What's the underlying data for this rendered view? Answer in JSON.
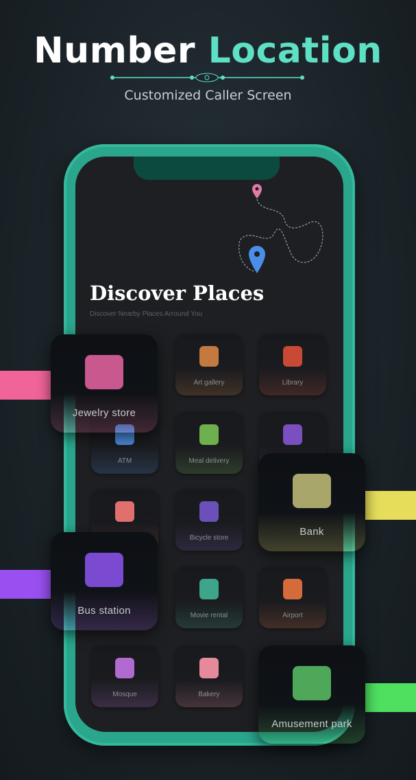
{
  "header": {
    "title_part1": "Number",
    "title_part2": "Location",
    "subtitle": "Customized Caller Screen"
  },
  "screen": {
    "title": "Discover Places",
    "subtitle": "Discover Nearby Places Arround You"
  },
  "tiles": [
    {
      "label": "Art gallery",
      "icon": "picture-frame-icon",
      "color": "#c47a3e"
    },
    {
      "label": "Library",
      "icon": "books-icon",
      "color": "#c84a35"
    },
    {
      "label": "ATM",
      "icon": "atm-machine-icon",
      "color": "#4a86d4"
    },
    {
      "label": "Meal delivery",
      "icon": "delivery-bag-icon",
      "color": "#6fb04e"
    },
    {
      "label": "",
      "icon": "auction-gavel-icon",
      "color": "#7a4fc0"
    },
    {
      "label": "",
      "icon": "hair-salon-icon",
      "color": "#e0706e"
    },
    {
      "label": "Bicycle store",
      "icon": "bicycle-icon",
      "color": "#6a50b8"
    },
    {
      "label": "Movie rental",
      "icon": "clapperboard-icon",
      "color": "#3da58a"
    },
    {
      "label": "Airport",
      "icon": "airplane-icon",
      "color": "#d56a3a"
    },
    {
      "label": "Mosque",
      "icon": "mosque-icon",
      "color": "#b06ad0"
    },
    {
      "label": "Bakery",
      "icon": "cake-icon",
      "color": "#e58a9a"
    }
  ],
  "cards": [
    {
      "label": "Jewelry store",
      "icon": "treasure-chest-icon",
      "color": "#c9588f",
      "accent": "#f0649a"
    },
    {
      "label": "Bank",
      "icon": "bank-building-icon",
      "color": "#a8a66a",
      "accent": "#e6de5a"
    },
    {
      "label": "Bus station",
      "icon": "bus-station-icon",
      "color": "#7a4ad0",
      "accent": "#9a50f0"
    },
    {
      "label": "Amusement park",
      "icon": "park-icon",
      "color": "#4fa85a",
      "accent": "#4fe060"
    }
  ],
  "colors": {
    "accent": "#5ee0c4",
    "frame": "#2aa68c"
  }
}
